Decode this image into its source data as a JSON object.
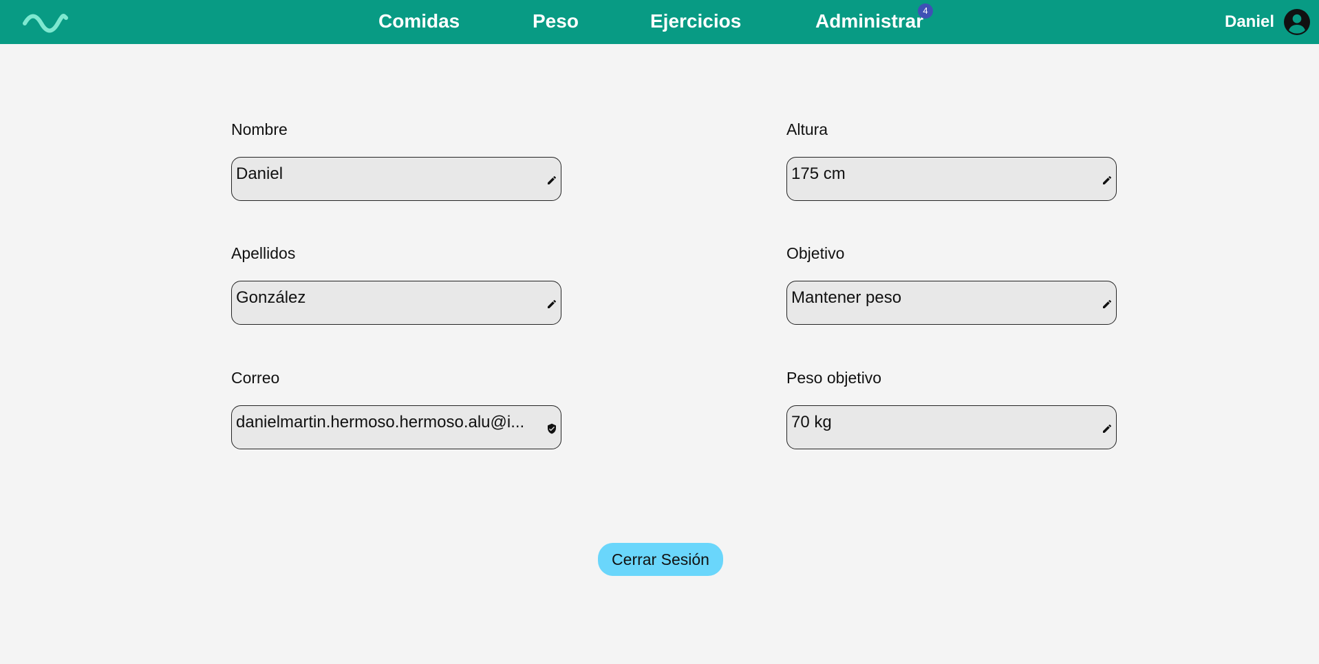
{
  "colors": {
    "header_bg": "#089b84",
    "logo": "#7ee8d0",
    "badge_bg": "#3f51b5",
    "field_bg": "#e8e8e8",
    "page_bg": "#f4f4f4",
    "logout_bg": "#6ad6fb"
  },
  "header": {
    "logo_icon": "wave-logo-icon",
    "nav": [
      {
        "label": "Comidas"
      },
      {
        "label": "Peso"
      },
      {
        "label": "Ejercicios"
      },
      {
        "label": "Administrar",
        "badge": "4"
      }
    ],
    "user": {
      "name": "Daniel",
      "icon": "account-circle-icon"
    }
  },
  "profile": {
    "left_fields": [
      {
        "label": "Nombre",
        "value": "Daniel",
        "icon": "pencil-icon"
      },
      {
        "label": "Apellidos",
        "value": "González",
        "icon": "pencil-icon"
      },
      {
        "label": "Correo",
        "value": "danielmartin.hermoso.hermoso.alu@i...",
        "icon": "shield-check-icon"
      }
    ],
    "right_fields": [
      {
        "label": "Altura",
        "value": "175 cm",
        "icon": "pencil-icon"
      },
      {
        "label": "Objetivo",
        "value": "Mantener peso",
        "icon": "pencil-icon"
      },
      {
        "label": "Peso objetivo",
        "value": "70 kg",
        "icon": "pencil-icon"
      }
    ],
    "logout_label": "Cerrar Sesión"
  }
}
